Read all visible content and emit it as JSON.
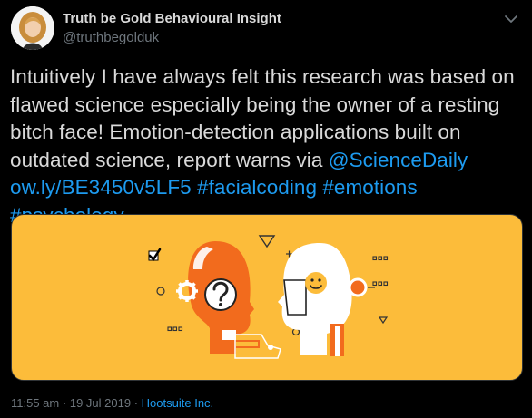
{
  "author": {
    "name": "Truth be Gold Behavioural Insight",
    "handle": "@truthbegolduk"
  },
  "tweet": {
    "text_before": "Intuitively I have always felt this research was based on flawed science especially being the owner of a resting bitch face! Emotion-detection applications built on outdated science, report warns via ",
    "mention": "@ScienceDaily",
    "link": "ow.ly/BE3450v5LF5",
    "hashtags": [
      "#facialcoding",
      "#emotions",
      "#psychology"
    ]
  },
  "meta": {
    "time": "11:55 am",
    "separator_1": "·",
    "date": "19 Jul 2019",
    "separator_2": "·",
    "source": "Hootsuite Inc."
  },
  "colors": {
    "background": "#000000",
    "text": "#d9d9d9",
    "muted": "#6e767d",
    "link": "#1d9bf0",
    "media_background": "#fcbc3a",
    "illustration_orange": "#f26b1d",
    "illustration_white": "#ffffff"
  },
  "icons": {
    "menu": "chevron-down-icon",
    "illustration_checkbox": "checkbox-icon",
    "illustration_gear": "gear-icon",
    "illustration_question": "question-mark-icon",
    "illustration_smiley": "smiley-icon"
  }
}
